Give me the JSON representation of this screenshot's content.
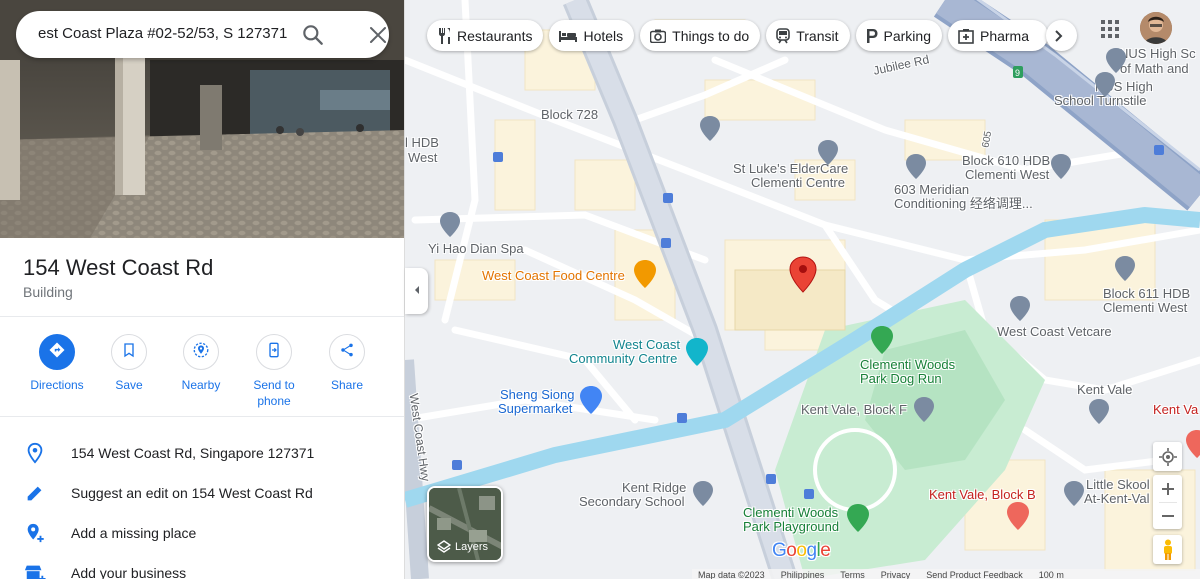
{
  "search": {
    "value": "est Coast Plaza #02-52/53, S 127371"
  },
  "place": {
    "title": "154 West Coast Rd",
    "category": "Building"
  },
  "actions": [
    {
      "label": "Directions",
      "icon": "directions-icon"
    },
    {
      "label": "Save",
      "icon": "bookmark-icon"
    },
    {
      "label": "Nearby",
      "icon": "nearby-icon"
    },
    {
      "label": "Send to phone",
      "icon": "send-to-phone-icon"
    },
    {
      "label": "Share",
      "icon": "share-icon"
    }
  ],
  "info_rows": [
    {
      "text": "154 West Coast Rd, Singapore 127371",
      "icon": "location-pin-icon"
    },
    {
      "text": "Suggest an edit on 154 West Coast Rd",
      "icon": "pencil-icon"
    },
    {
      "text": "Add a missing place",
      "icon": "add-place-icon"
    },
    {
      "text": "Add your business",
      "icon": "storefront-icon"
    }
  ],
  "chips": [
    {
      "label": "Restaurants",
      "icon": "fork-knife-icon"
    },
    {
      "label": "Hotels",
      "icon": "bed-icon"
    },
    {
      "label": "Things to do",
      "icon": "camera-icon"
    },
    {
      "label": "Transit",
      "icon": "train-icon"
    },
    {
      "label": "Parking",
      "icon": "parking-icon"
    },
    {
      "label": "Pharma",
      "icon": "pharmacy-icon"
    }
  ],
  "map_labels": {
    "block728": "Block 728",
    "hdb_west_1": "l HDB",
    "hdb_west_2": "West",
    "jubilee": "Jubilee Rd",
    "nus_high_1": "NUS High Sc",
    "nus_high_2": "of Math and",
    "nus_turnstile_1": "NUS High",
    "nus_turnstile_2": "School Turnstile",
    "st_lukes_1": "St Luke's ElderCare",
    "st_lukes_2": "Clementi Centre",
    "block610_1": "Block 610 HDB",
    "block610_2": "Clementi West",
    "meridian_1": "603 Meridian",
    "meridian_2": "Conditioning 经络调理...",
    "yihao": "Yi Hao Dian Spa",
    "food_centre": "West Coast Food Centre",
    "block611_1": "Block 611 HDB",
    "block611_2": "Clementi West",
    "vetcare": "West Coast Vetcare",
    "community_1": "West Coast",
    "community_2": "Community Centre",
    "dog_run_1": "Clementi Woods",
    "dog_run_2": "Park Dog Run",
    "sheng_siong_1": "Sheng Siong",
    "sheng_siong_2": "Supermarket",
    "kent_vale": "Kent Vale",
    "kent_vale_f": "Kent Vale, Block F",
    "kent_vale_right": "Kent Va",
    "kent_ridge_1": "Kent Ridge",
    "kent_ridge_2": "Secondary School",
    "kent_vale_b": "Kent Vale, Block B",
    "little_skool_1": "Little Skool",
    "little_skool_2": "At-Kent-Val",
    "playground_1": "Clementi Woods",
    "playground_2": "Park Playground",
    "west_coast_hwy": "West Coast Hwy",
    "road_605": "605",
    "road_9": "9"
  },
  "layers": {
    "label": "Layers"
  },
  "footer": {
    "map_data": "Map data ©2023",
    "country": "Philippines",
    "terms": "Terms",
    "privacy": "Privacy",
    "feedback": "Send Product Feedback",
    "scale": "100 m"
  },
  "logo": "Google",
  "colors": {
    "accent": "#1a73e8",
    "pin": "#ea4335",
    "highway": "#a8b7d3",
    "canal": "#9fd8ef",
    "park": "#c8ecd2",
    "building": "#fbf3dc"
  }
}
